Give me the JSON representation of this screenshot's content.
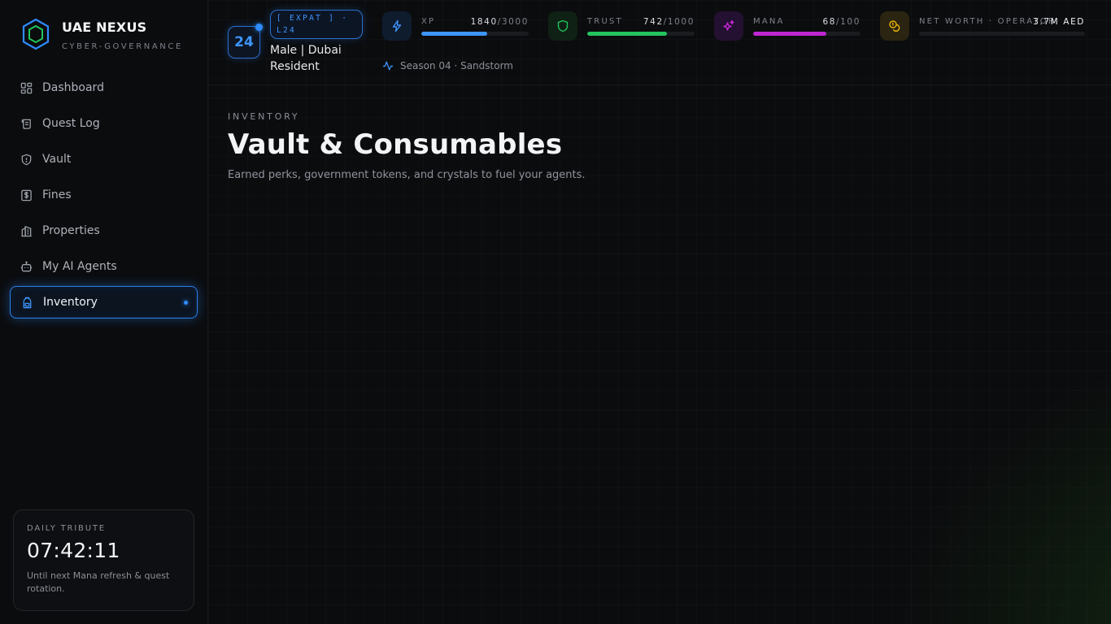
{
  "brand": {
    "name": "UAE NEXUS",
    "subtitle": "CYBER-GOVERNANCE"
  },
  "sidebar": {
    "items": [
      {
        "label": "Dashboard",
        "icon": "grid-icon",
        "active": false
      },
      {
        "label": "Quest Log",
        "icon": "scroll-icon",
        "active": false
      },
      {
        "label": "Vault",
        "icon": "shield-icon",
        "active": false
      },
      {
        "label": "Fines",
        "icon": "dollar-icon",
        "active": false
      },
      {
        "label": "Properties",
        "icon": "building-icon",
        "active": false
      },
      {
        "label": "My AI Agents",
        "icon": "bot-icon",
        "active": false
      },
      {
        "label": "Inventory",
        "icon": "backpack-icon",
        "active": true
      }
    ]
  },
  "tribute": {
    "label": "DAILY TRIBUTE",
    "time": "07:42:11",
    "note": "Until next Mana refresh & quest rotation."
  },
  "header": {
    "level": "24",
    "class_tag": "[ EXPAT ] · L24",
    "identity": "Male | Dubai Resident",
    "season": "Season 04 · Sandstorm",
    "stats": [
      {
        "key": "xp",
        "label": "XP",
        "value": "1840",
        "max": "/3000",
        "fraction": 0.6133,
        "color": "#3d95ff",
        "icon": "bolt-icon"
      },
      {
        "key": "trust",
        "label": "TRUST",
        "value": "742",
        "max": "/1000",
        "fraction": 0.742,
        "color": "#22c55e",
        "icon": "shield-icon"
      },
      {
        "key": "mana",
        "label": "MANA",
        "value": "68",
        "max": "/100",
        "fraction": 0.68,
        "color": "#c026d3",
        "icon": "sparkles-icon"
      },
      {
        "key": "net_worth",
        "label": "NET WORTH · OPERATOR",
        "value": "3.7M AED",
        "max": "",
        "fraction": 0.0,
        "color": "#eab308",
        "icon": "coins-icon"
      }
    ]
  },
  "page": {
    "eyebrow": "INVENTORY",
    "title": "Vault & Consumables",
    "subtitle": "Earned perks, government tokens, and crystals to fuel your agents."
  },
  "colors": {
    "accent": "#2f8cff",
    "background": "#0a0b0d"
  }
}
